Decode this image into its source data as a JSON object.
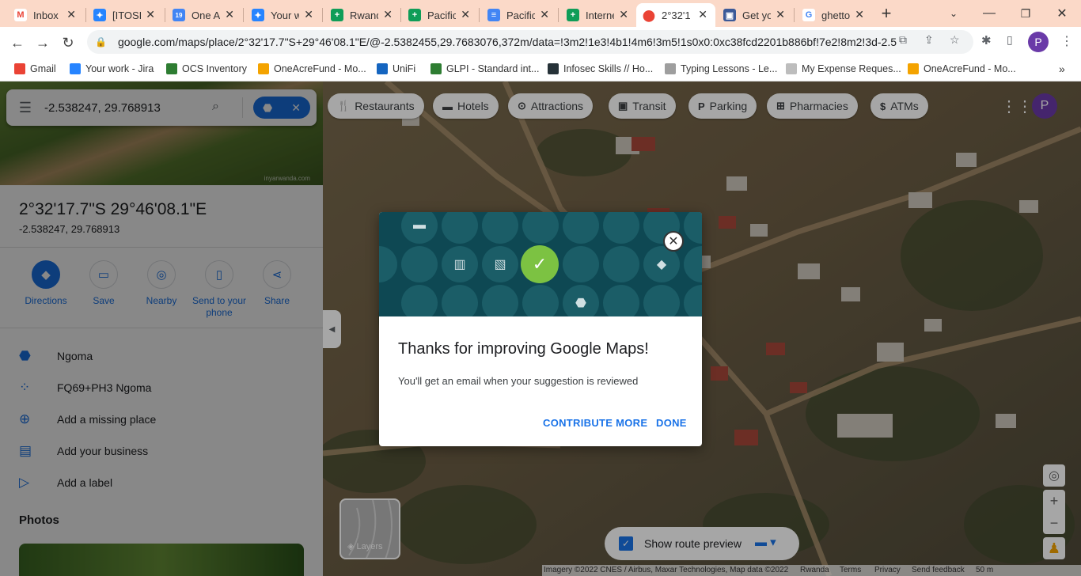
{
  "browser": {
    "tabs": [
      {
        "label": "Inbox",
        "icon": "gmail-icon",
        "color": "#ea4335",
        "glyph": "M"
      },
      {
        "label": "[ITOSD",
        "icon": "jira-icon",
        "color": "#2684ff",
        "glyph": "✦"
      },
      {
        "label": "One A",
        "icon": "calendar-icon",
        "color": "#4285f4",
        "glyph": "19"
      },
      {
        "label": "Your w",
        "icon": "jira-icon",
        "color": "#2684ff",
        "glyph": "✦"
      },
      {
        "label": "Rwand",
        "icon": "sheets-icon",
        "color": "#0f9d58",
        "glyph": "+"
      },
      {
        "label": "Pacific",
        "icon": "sheets-icon",
        "color": "#0f9d58",
        "glyph": "+"
      },
      {
        "label": "Pacific",
        "icon": "docs-icon",
        "color": "#4285f4",
        "glyph": "≡"
      },
      {
        "label": "Interne",
        "icon": "sheets-icon",
        "color": "#0f9d58",
        "glyph": "+"
      },
      {
        "label": "2°32'1",
        "icon": "maps-icon",
        "color": "#ea4335",
        "glyph": "●"
      },
      {
        "label": "Get yo",
        "icon": "meet-icon",
        "color": "#3b5998",
        "glyph": "▣"
      },
      {
        "label": "ghetto",
        "icon": "google-icon",
        "color": "#4285f4",
        "glyph": "G"
      }
    ],
    "url": "google.com/maps/place/2°32'17.7\"S+29°46'08.1\"E/@-2.5382455,29.7683076,372m/data=!3m2!1e3!4b1!4m6!3m5!1s0x0:0xc38fcd2201b886bf!7e2!8m2!3d-2.5...",
    "profile_initial": "P",
    "bookmarks": [
      {
        "label": "Gmail",
        "color": "#ea4335"
      },
      {
        "label": "Your work - Jira",
        "color": "#2684ff"
      },
      {
        "label": "OCS Inventory",
        "color": "#2e7d32"
      },
      {
        "label": "OneAcreFund - Mo...",
        "color": "#f4a300"
      },
      {
        "label": "UniFi",
        "color": "#1565c0"
      },
      {
        "label": "GLPI - Standard int...",
        "color": "#2e7d32"
      },
      {
        "label": "Infosec Skills // Ho...",
        "color": "#263238"
      },
      {
        "label": "Typing Lessons - Le...",
        "color": "#9e9e9e"
      },
      {
        "label": "My Expense Reques...",
        "color": "#bdbdbd"
      },
      {
        "label": "OneAcreFund - Mo...",
        "color": "#f4a300"
      }
    ]
  },
  "sidebar": {
    "search_query": "-2.538247, 29.768913",
    "title": "2°32'17.7\"S 29°46'08.1\"E",
    "subtitle": "-2.538247, 29.768913",
    "actions": [
      {
        "label": "Directions",
        "icon": "directions-icon"
      },
      {
        "label": "Save",
        "icon": "bookmark-icon"
      },
      {
        "label": "Nearby",
        "icon": "nearby-icon"
      },
      {
        "label": "Send to your phone",
        "icon": "phone-icon"
      },
      {
        "label": "Share",
        "icon": "share-icon"
      }
    ],
    "info_items": [
      {
        "label": "Ngoma",
        "icon": "location-pin-icon"
      },
      {
        "label": "FQ69+PH3 Ngoma",
        "icon": "plus-code-icon"
      },
      {
        "label": "Add a missing place",
        "icon": "add-place-icon"
      },
      {
        "label": "Add your business",
        "icon": "storefront-icon"
      },
      {
        "label": "Add a label",
        "icon": "label-icon"
      }
    ],
    "photos_heading": "Photos",
    "photo_watermark": "inyarwanda.com"
  },
  "map": {
    "chips": [
      {
        "label": "Restaurants",
        "icon": "restaurant-icon"
      },
      {
        "label": "Hotels",
        "icon": "hotel-icon"
      },
      {
        "label": "Attractions",
        "icon": "attractions-icon"
      },
      {
        "label": "Transit",
        "icon": "transit-icon"
      },
      {
        "label": "Parking",
        "icon": "parking-icon"
      },
      {
        "label": "Pharmacies",
        "icon": "pharmacy-icon"
      },
      {
        "label": "ATMs",
        "icon": "atm-icon"
      }
    ],
    "avatar_initial": "P",
    "layers_label": "Layers",
    "route_preview_label": "Show route preview",
    "attribution": {
      "imagery": "Imagery ©2022 CNES / Airbus, Maxar Technologies, Map data ©2022",
      "region": "Rwanda",
      "terms": "Terms",
      "privacy": "Privacy",
      "feedback": "Send feedback",
      "scale": "50 m"
    }
  },
  "dialog": {
    "title": "Thanks for improving Google Maps!",
    "body": "You'll get an email when your suggestion is reviewed",
    "contribute_label": "CONTRIBUTE MORE",
    "done_label": "DONE",
    "accent_color": "#7cc242",
    "banner_color": "#0e4853"
  }
}
